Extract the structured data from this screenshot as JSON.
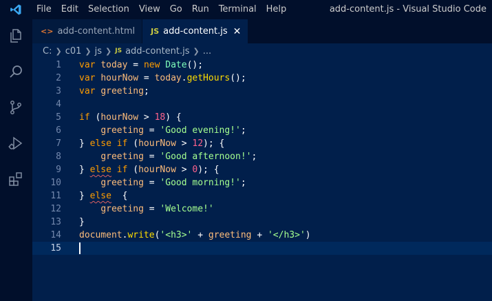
{
  "window_title": "add-content.js - Visual Studio Code",
  "menu": [
    "File",
    "Edit",
    "Selection",
    "View",
    "Go",
    "Run",
    "Terminal",
    "Help"
  ],
  "tabs": [
    {
      "label": "add-content.html",
      "icon": "<>",
      "active": false
    },
    {
      "label": "add-content.js",
      "icon": "JS",
      "active": true,
      "close": "✕"
    }
  ],
  "breadcrumb": {
    "parts": [
      "C:",
      "c01",
      "js"
    ],
    "file_icon": "JS",
    "file": "add-content.js",
    "more": "..."
  },
  "editor": {
    "lines": [
      {
        "n": "1",
        "tokens": [
          [
            "kw",
            "var"
          ],
          [
            "pun",
            " "
          ],
          [
            "var",
            "today"
          ],
          [
            "pun",
            " = "
          ],
          [
            "kw",
            "new"
          ],
          [
            "pun",
            " "
          ],
          [
            "cls",
            "Date"
          ],
          [
            "pun",
            "();"
          ]
        ]
      },
      {
        "n": "2",
        "tokens": [
          [
            "kw",
            "var"
          ],
          [
            "pun",
            " "
          ],
          [
            "var",
            "hourNow"
          ],
          [
            "pun",
            " = "
          ],
          [
            "var",
            "today"
          ],
          [
            "pun",
            "."
          ],
          [
            "fn",
            "getHours"
          ],
          [
            "pun",
            "();"
          ]
        ]
      },
      {
        "n": "3",
        "tokens": [
          [
            "kw",
            "var"
          ],
          [
            "pun",
            " "
          ],
          [
            "var",
            "greeting"
          ],
          [
            "pun",
            ";"
          ]
        ]
      },
      {
        "n": "4",
        "tokens": []
      },
      {
        "n": "5",
        "tokens": [
          [
            "kw",
            "if"
          ],
          [
            "pun",
            " ("
          ],
          [
            "var",
            "hourNow"
          ],
          [
            "pun",
            " > "
          ],
          [
            "num",
            "18"
          ],
          [
            "pun",
            ") {"
          ]
        ]
      },
      {
        "n": "6",
        "tokens": [
          [
            "pun",
            "    "
          ],
          [
            "var",
            "greeting"
          ],
          [
            "pun",
            " = "
          ],
          [
            "str",
            "'Good evening!'"
          ],
          [
            "pun",
            ";"
          ]
        ]
      },
      {
        "n": "7",
        "tokens": [
          [
            "pun",
            "} "
          ],
          [
            "kw",
            "else"
          ],
          [
            "pun",
            " "
          ],
          [
            "kw",
            "if"
          ],
          [
            "pun",
            " ("
          ],
          [
            "var",
            "hourNow"
          ],
          [
            "pun",
            " > "
          ],
          [
            "num",
            "12"
          ],
          [
            "pun",
            "); {"
          ]
        ]
      },
      {
        "n": "8",
        "tokens": [
          [
            "pun",
            "    "
          ],
          [
            "var",
            "greeting"
          ],
          [
            "pun",
            " = "
          ],
          [
            "str",
            "'Good afternoon!'"
          ],
          [
            "pun",
            ";"
          ]
        ]
      },
      {
        "n": "9",
        "tokens": [
          [
            "pun",
            "} "
          ],
          [
            "kw squig",
            "else"
          ],
          [
            "pun",
            " "
          ],
          [
            "kw",
            "if"
          ],
          [
            "pun",
            " ("
          ],
          [
            "var",
            "hourNow"
          ],
          [
            "pun",
            " > "
          ],
          [
            "num",
            "0"
          ],
          [
            "pun",
            "); {"
          ]
        ]
      },
      {
        "n": "10",
        "tokens": [
          [
            "pun",
            "    "
          ],
          [
            "var",
            "greeting"
          ],
          [
            "pun",
            " = "
          ],
          [
            "str",
            "'Good morning!'"
          ],
          [
            "pun",
            ";"
          ]
        ]
      },
      {
        "n": "11",
        "tokens": [
          [
            "pun",
            "} "
          ],
          [
            "kw squig",
            "else"
          ],
          [
            "pun",
            "  {"
          ]
        ]
      },
      {
        "n": "12",
        "tokens": [
          [
            "pun",
            "    "
          ],
          [
            "var",
            "greeting"
          ],
          [
            "pun",
            " = "
          ],
          [
            "str",
            "'Welcome!'"
          ]
        ]
      },
      {
        "n": "13",
        "tokens": [
          [
            "pun",
            "}"
          ]
        ]
      },
      {
        "n": "14",
        "tokens": [
          [
            "var",
            "document"
          ],
          [
            "pun",
            "."
          ],
          [
            "fn",
            "write"
          ],
          [
            "pun",
            "("
          ],
          [
            "str",
            "'<h3>'"
          ],
          [
            "pun",
            " + "
          ],
          [
            "var",
            "greeting"
          ],
          [
            "pun",
            " + "
          ],
          [
            "str",
            "'</h3>'"
          ],
          [
            "pun",
            ")"
          ]
        ]
      },
      {
        "n": "15",
        "tokens": [],
        "current": true
      }
    ]
  },
  "colors": {
    "editor_bg": "#011f4b",
    "chrome_bg": "#010f2b",
    "keyword": "#ff9d00",
    "variable": "#ffbd7b",
    "string": "#a5ff90",
    "number": "#ff628c",
    "function": "#ffdd00",
    "class": "#80ffbb"
  },
  "icons": [
    "vscode-logo-icon",
    "explorer-icon",
    "search-icon",
    "source-control-icon",
    "run-debug-icon",
    "extensions-icon"
  ]
}
